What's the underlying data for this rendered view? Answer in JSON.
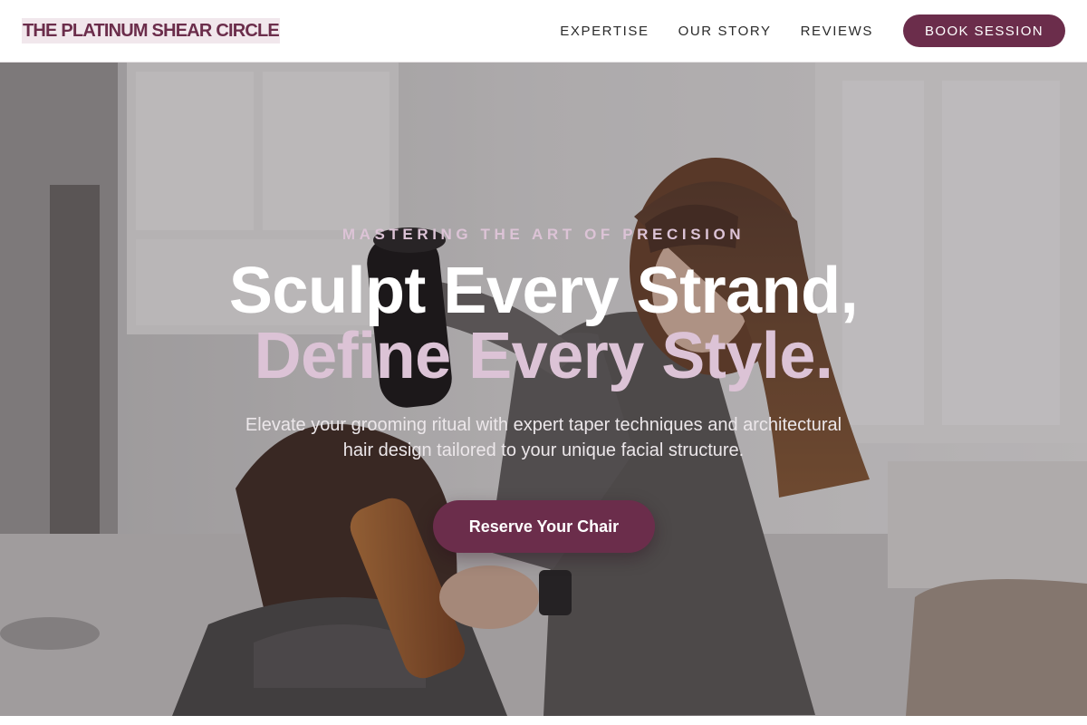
{
  "nav": {
    "logo": "THE PLATINUM SHEAR CIRCLE",
    "links": [
      "EXPERTISE",
      "OUR STORY",
      "REVIEWS"
    ],
    "cta": "BOOK SESSION"
  },
  "hero": {
    "eyebrow": "MASTERING THE ART OF PRECISION",
    "headline_line1": "Sculpt Every Strand,",
    "headline_line2": "Define Every Style.",
    "subtext": "Elevate your grooming ritual with expert taper techniques and architectural hair design tailored to your unique facial structure.",
    "cta": "Reserve Your Chair",
    "background_image": "salon-stylist-blow-drying-client-photo"
  },
  "colors": {
    "brand": "#6b2d4b",
    "accent_text": "#dcc3d6",
    "logo_highlight": "#f1e7ec"
  }
}
